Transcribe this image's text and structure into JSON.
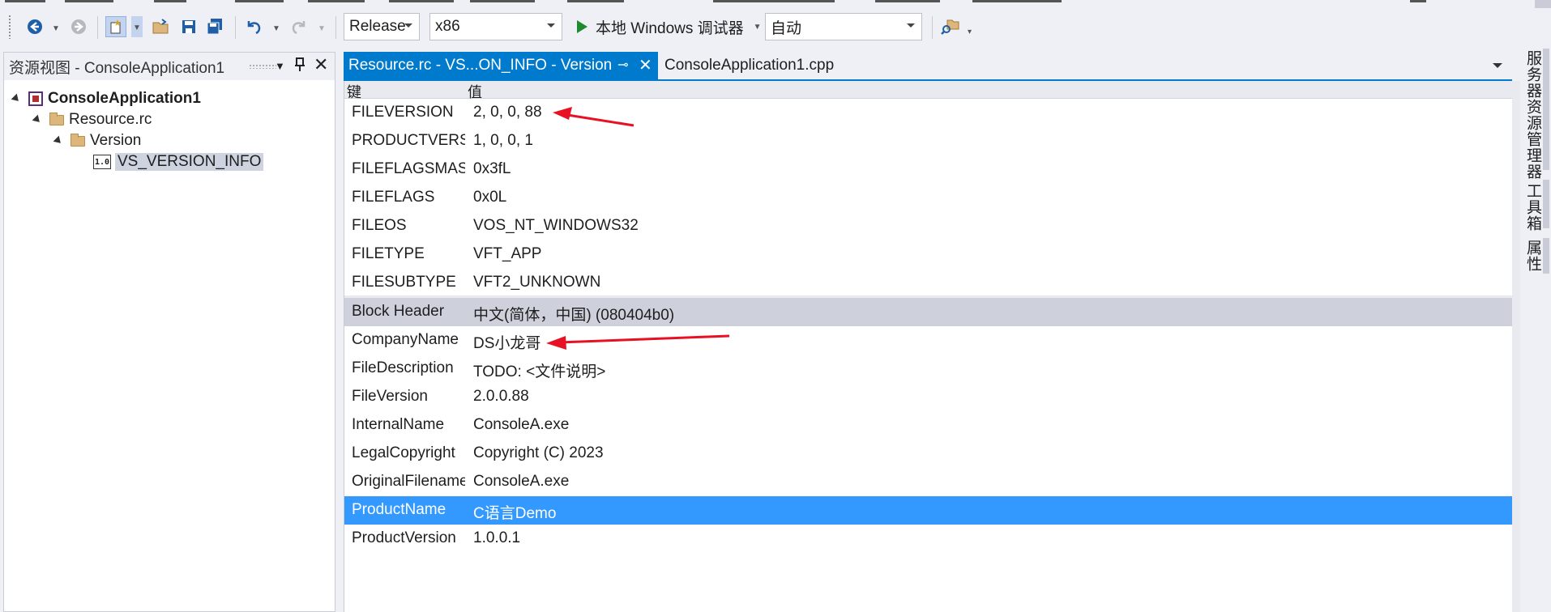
{
  "toolbar": {
    "config": "Release",
    "platform": "x86",
    "run_label": "本地 Windows 调试器",
    "mode": "自动"
  },
  "resource_view": {
    "title": "资源视图 - ConsoleApplication1",
    "tree": {
      "project": "ConsoleApplication1",
      "rc": "Resource.rc",
      "folder": "Version",
      "item": "VS_VERSION_INFO",
      "item_icon_text": "1.0"
    }
  },
  "tabs": {
    "active": "Resource.rc - VS...ON_INFO - Version",
    "inactive": "ConsoleApplication1.cpp"
  },
  "table": {
    "col_key": "键",
    "col_value": "值",
    "fixed": [
      {
        "key": "FILEVERSION",
        "value": "2, 0, 0, 88"
      },
      {
        "key": "PRODUCTVERSION",
        "value": "1, 0, 0, 1"
      },
      {
        "key": "FILEFLAGSMASK",
        "value": "0x3fL"
      },
      {
        "key": "FILEFLAGS",
        "value": "0x0L"
      },
      {
        "key": "FILEOS",
        "value": "VOS_NT_WINDOWS32"
      },
      {
        "key": "FILETYPE",
        "value": "VFT_APP"
      },
      {
        "key": "FILESUBTYPE",
        "value": "VFT2_UNKNOWN"
      }
    ],
    "block_header": {
      "key": "Block Header",
      "value": "中文(简体，中国) (080404b0)"
    },
    "strings": [
      {
        "key": "CompanyName",
        "value": "DS小龙哥"
      },
      {
        "key": "FileDescription",
        "value": "TODO: <文件说明>"
      },
      {
        "key": "FileVersion",
        "value": "2.0.0.88"
      },
      {
        "key": "InternalName",
        "value": "ConsoleA.exe"
      },
      {
        "key": "LegalCopyright",
        "value": "Copyright (C) 2023"
      },
      {
        "key": "OriginalFilename",
        "value": "ConsoleA.exe"
      },
      {
        "key": "ProductName",
        "value": "C语言Demo"
      },
      {
        "key": "ProductVersion",
        "value": "1.0.0.1"
      }
    ]
  },
  "side_tabs": {
    "server": "服务器资源管理器",
    "toolbox": "工具箱",
    "props": "属性"
  },
  "colors": {
    "accent": "#007acc",
    "selection": "#3399ff",
    "annotation": "#e81123"
  }
}
